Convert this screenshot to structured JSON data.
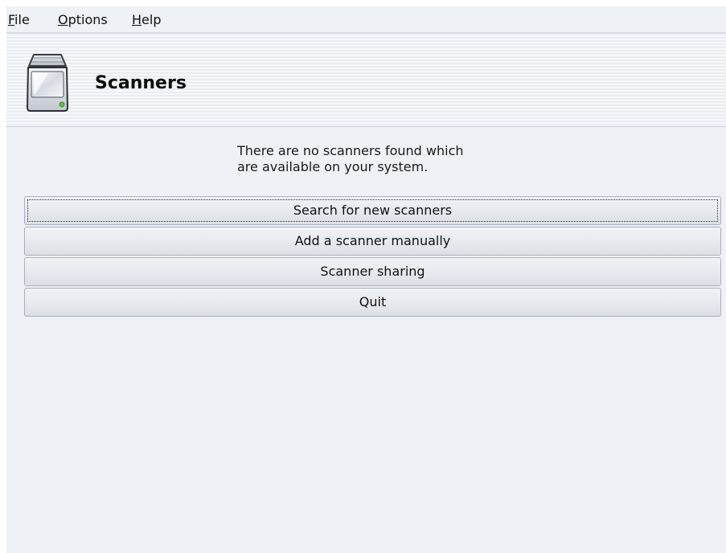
{
  "menu": {
    "file": {
      "mnemonic": "F",
      "rest": "ile"
    },
    "options": {
      "mnemonic": "O",
      "rest": "ptions"
    },
    "help": {
      "mnemonic": "H",
      "rest": "elp"
    }
  },
  "banner": {
    "icon": "scanner-icon",
    "title": "Scanners"
  },
  "message": {
    "line1": "There are no scanners found which",
    "line2": "are available on your system."
  },
  "buttons": {
    "search": "Search for new scanners",
    "add": "Add a scanner manually",
    "sharing": "Scanner sharing",
    "quit": "Quit"
  },
  "colors": {
    "window_bg": "#eef1f6",
    "button_border": "#a9b1bd",
    "status_led": "#5cc83a"
  }
}
